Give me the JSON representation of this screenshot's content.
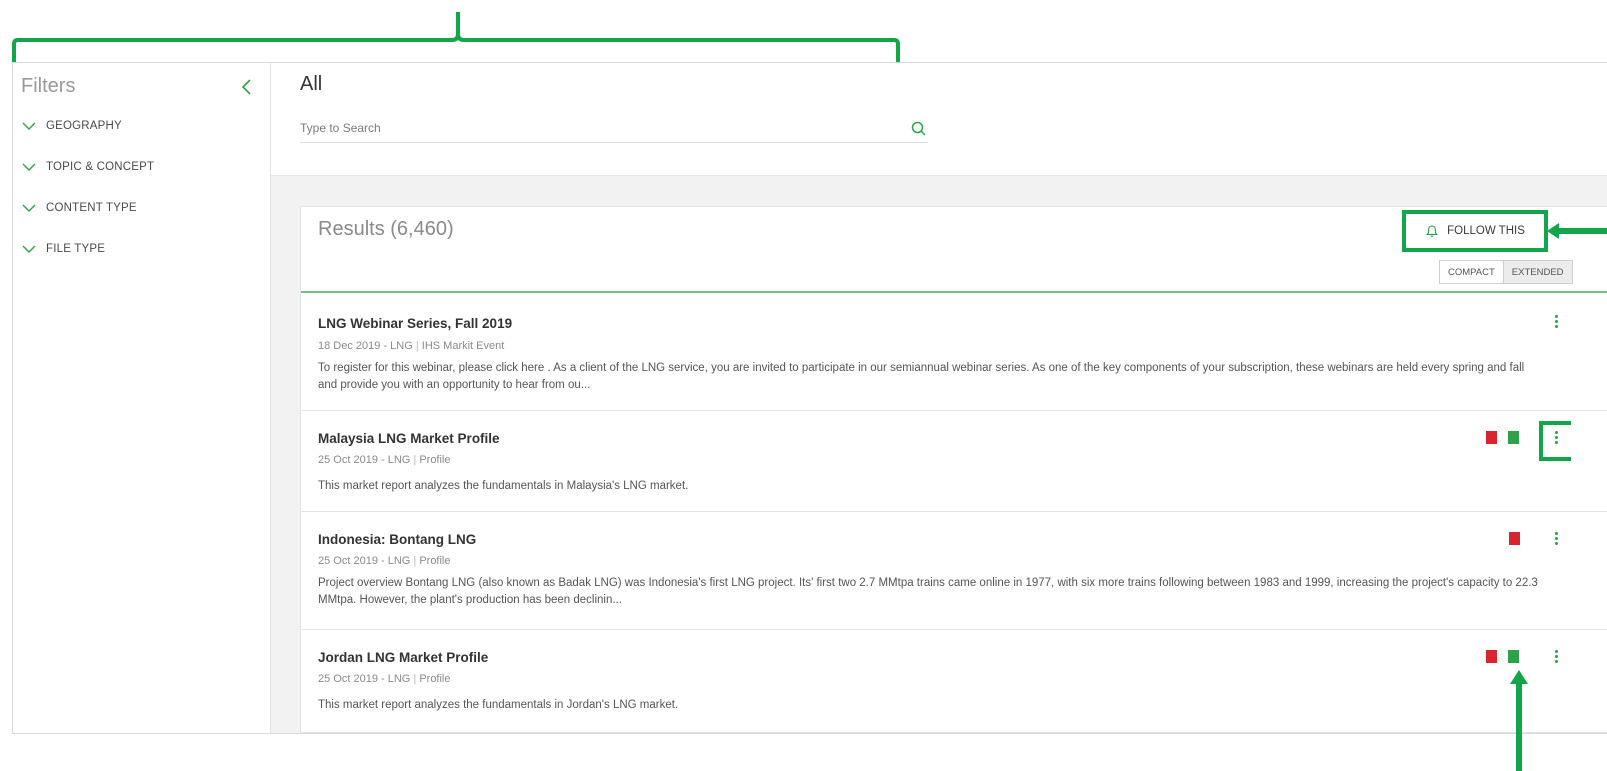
{
  "sidebar": {
    "title": "Filters",
    "filters": [
      {
        "label": "GEOGRAPHY"
      },
      {
        "label": "TOPIC & CONCEPT"
      },
      {
        "label": "CONTENT TYPE"
      },
      {
        "label": "FILE TYPE"
      }
    ]
  },
  "main": {
    "title": "All",
    "search": {
      "placeholder": "Type to Search",
      "value": ""
    }
  },
  "results": {
    "title": "Results (6,460)",
    "follow_label": "FOLLOW THIS",
    "view_toggle": {
      "compact": "COMPACT",
      "extended": "EXTENDED",
      "selected": "COMPACT"
    },
    "items": [
      {
        "title": "LNG Webinar Series, Fall 2019",
        "date": "18 Dec 2019 - LNG",
        "type": "IHS Markit Event",
        "description": "To register for this webinar, please click here . As a client of the LNG service, you are invited to participate in our semiannual webinar series. As one of the key components of your subscription, these webinars are held every spring and fall and provide you with an opportunity to hear from ou...",
        "files": []
      },
      {
        "title": "Malaysia LNG Market Profile",
        "date": "25 Oct 2019 - LNG",
        "type": "Profile",
        "description": "This market report analyzes the fundamentals in Malaysia's LNG market.",
        "files": [
          "pdf",
          "xls"
        ]
      },
      {
        "title": "Indonesia: Bontang LNG",
        "date": "25 Oct 2019 - LNG",
        "type": "Profile",
        "description": "Project overview Bontang LNG (also known as Badak LNG) was Indonesia's first LNG project. Its' first two 2.7 MMtpa trains came online in 1977, with six more trains following between 1983 and 1999, increasing the project's capacity to 22.3 MMtpa. However, the plant's production has been declinin...",
        "files": [
          "pdf"
        ]
      },
      {
        "title": "Jordan LNG Market Profile",
        "date": "25 Oct 2019 - LNG",
        "type": "Profile",
        "description": "This market report analyzes the fundamentals in Jordan's LNG market.",
        "files": [
          "pdf",
          "xls"
        ]
      }
    ]
  },
  "colors": {
    "accent_green": "#12a54a",
    "pdf_red": "#d9232f",
    "xls_green": "#2ea24a",
    "divider_green": "#78c08a"
  },
  "icons": {
    "collapse": "chevron-left-icon",
    "filter_expand": "chevron-down-icon",
    "search": "search-icon",
    "follow": "bell-icon",
    "pdf": "pdf-file-icon",
    "xls": "excel-file-icon",
    "more": "kebab-menu-icon"
  }
}
